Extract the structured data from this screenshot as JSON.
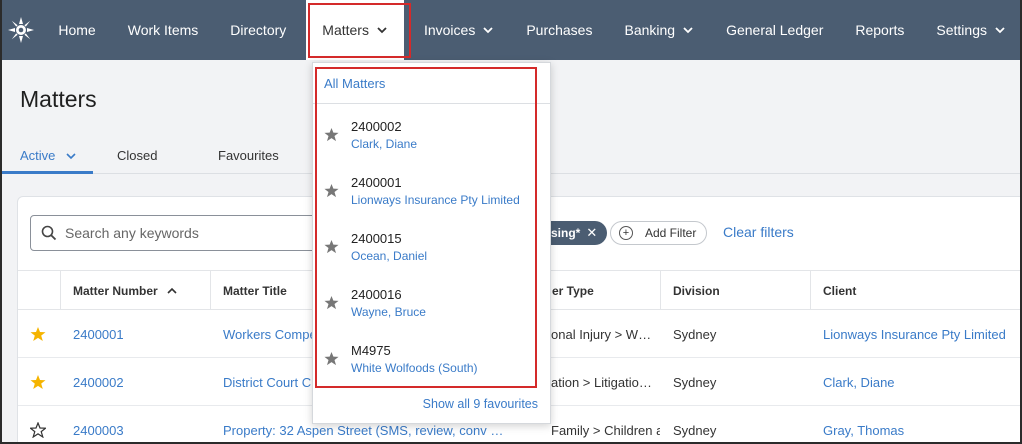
{
  "nav": {
    "items": [
      {
        "label": "Home",
        "dropdown": false
      },
      {
        "label": "Work Items",
        "dropdown": false
      },
      {
        "label": "Directory",
        "dropdown": false
      },
      {
        "label": "Matters",
        "dropdown": true,
        "active": true
      },
      {
        "label": "Invoices",
        "dropdown": true
      },
      {
        "label": "Purchases",
        "dropdown": false
      },
      {
        "label": "Banking",
        "dropdown": true
      },
      {
        "label": "General Ledger",
        "dropdown": false
      },
      {
        "label": "Reports",
        "dropdown": false
      },
      {
        "label": "Settings",
        "dropdown": true
      }
    ],
    "bg_color": "#4b5d72",
    "logo_icon": "sun-logo-icon"
  },
  "page": {
    "title": "Matters",
    "tabs": [
      {
        "label": "Active",
        "active": true
      },
      {
        "label": "Closed"
      },
      {
        "label": "Favourites"
      }
    ]
  },
  "filters": {
    "search_placeholder": "Search any keywords",
    "chip_label": "sing*",
    "add_filter": "Add Filter",
    "clear_filters": "Clear filters"
  },
  "table": {
    "columns": [
      "Matter Number",
      "Matter Title",
      "er Type",
      "Division",
      "Client"
    ],
    "rows": [
      {
        "favourite": true,
        "number": "2400001",
        "title": "Workers Compe",
        "type": "onal Injury > W…",
        "division": "Sydney",
        "client": "Lionways Insurance Pty Limited"
      },
      {
        "favourite": true,
        "number": "2400002",
        "title": "District Court C",
        "type": "ation > Litigatio…",
        "division": "Sydney",
        "client": "Clark, Diane"
      },
      {
        "favourite": false,
        "number": "2400003",
        "title": "Property: 32 Aspen Street (SMS, review, conv …",
        "type": "Family > Children a…",
        "division": "Sydney",
        "client": "Gray, Thomas"
      }
    ]
  },
  "dropdown": {
    "all_label": "All Matters",
    "favourites": [
      {
        "number": "2400002",
        "client": "Clark, Diane"
      },
      {
        "number": "2400001",
        "client": "Lionways Insurance Pty Limited"
      },
      {
        "number": "2400015",
        "client": "Ocean, Daniel"
      },
      {
        "number": "2400016",
        "client": "Wayne, Bruce"
      },
      {
        "number": "M4975",
        "client": "White Wolfoods (South)"
      }
    ],
    "show_all": "Show all 9 favourites"
  },
  "colors": {
    "accent": "#3a7bc8",
    "highlight_box": "#d42a2a",
    "star_filled": "#f5b400"
  }
}
